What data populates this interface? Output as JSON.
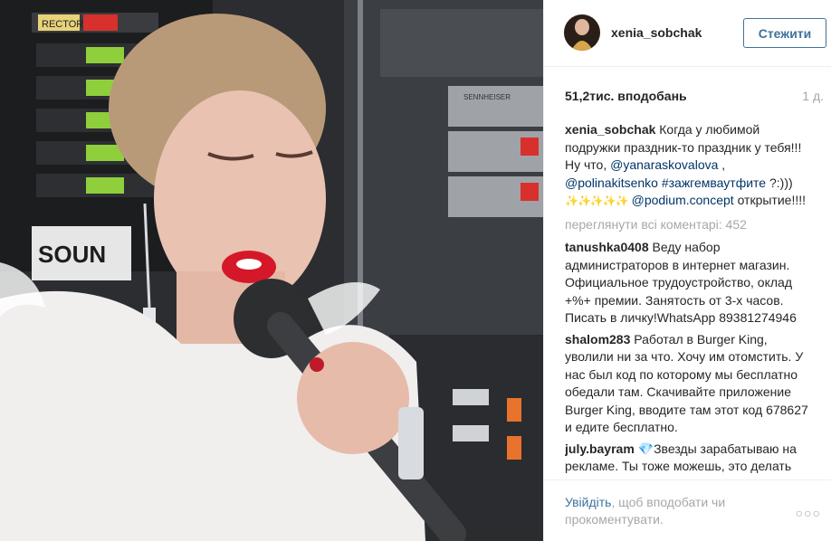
{
  "post": {
    "username": "xenia_sobchak",
    "follow_label": "Стежити",
    "likes": "51,2тис. вподобань",
    "time": "1 д.",
    "caption": {
      "user": "xenia_sobchak",
      "text1": "Когда у любимой подружки праздник-то праздник у тебя!!! Ну что,",
      "tag1": "@yanaraskovalova",
      "text2": ",",
      "tag2": "@polinakitsenko",
      "tag3": "#зажгемваутфите",
      "text3": "?:)))",
      "emoji": "✨✨✨✨✨",
      "tag4": "@podium.concept",
      "text4": "открытие!!!!"
    },
    "view_all": "переглянути всі коментарі: 452",
    "comments": [
      {
        "user": "tanushka0408",
        "text": "Веду набор администраторов в интернет магазин. Официальное трудоустройство, оклад +%+ премии. Занятость от 3-х часов. Писать в личку!WhatsApp 89381274946"
      },
      {
        "user": "shalom283",
        "text": "Работал в Burger King, уволили ни за что. Хочу им отомстить. У нас был код по которому мы бесплатно обедали там. Скачивайте приложение Burger King, вводите там этот код 678627 и едите бесплатно."
      },
      {
        "user": "july.bayram",
        "text": "💎Звезды зарабатываю на рекламе. Ты тоже можешь, это делать"
      }
    ],
    "login_link": "Увійдіть",
    "login_rest": ", щоб вподобати чи прокоментувати.",
    "more_label": "○○○"
  },
  "photo": {
    "rack_label_1": "RECTOR",
    "rack_label_2": "SOUN",
    "brand_label": "SENNHEISER",
    "colors": {
      "background": "#2b2d30",
      "rack_dark": "#1c1d1f",
      "panel_grey": "#9fa3a8",
      "green_led": "#8fcf3c",
      "lips": "#d4182a",
      "skin": "#e9c2b1",
      "dress": "#f1eeee",
      "hair": "#b99a78"
    }
  }
}
